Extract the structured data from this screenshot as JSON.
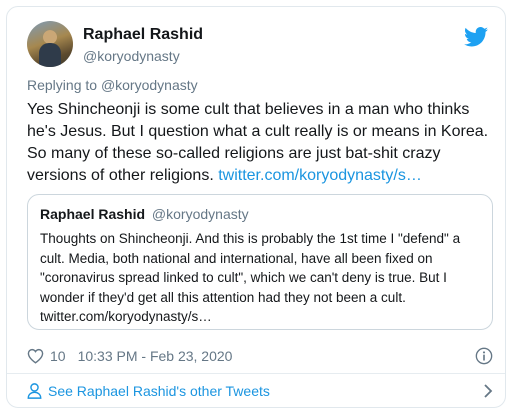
{
  "author": {
    "name": "Raphael Rashid",
    "handle": "@koryodynasty"
  },
  "reply": {
    "prefix": "Replying to ",
    "to_handle": "@koryodynasty"
  },
  "tweet": {
    "text": "Yes Shincheonji is some cult that believes in a man who thinks he's Jesus. But I question what a cult really is or means in Korea. So many of these so-called religions are just bat-shit crazy versions of other religions. ",
    "link": "twitter.com/koryodynasty/s…"
  },
  "quoted": {
    "name": "Raphael Rashid",
    "handle": "@koryodynasty",
    "text": "Thoughts on Shincheonji. And this is probably the 1st time I \"defend\" a cult. Media, both national and international, have all been fixed on \"coronavirus spread linked to cult\", which we can't deny is true. But I wonder if they'd get all this attention had they not been a cult. twitter.com/koryodynasty/s…"
  },
  "meta": {
    "likes": "10",
    "timestamp": "10:33 PM - Feb 23, 2020"
  },
  "footer": {
    "label": "See Raphael Rashid's other Tweets"
  },
  "colors": {
    "link": "#1b95e0",
    "secondary_text": "#657786",
    "border": "#ccd6dd"
  },
  "icons": [
    "twitter-bird-icon",
    "heart-icon",
    "info-icon",
    "person-icon",
    "chevron-right-icon"
  ]
}
